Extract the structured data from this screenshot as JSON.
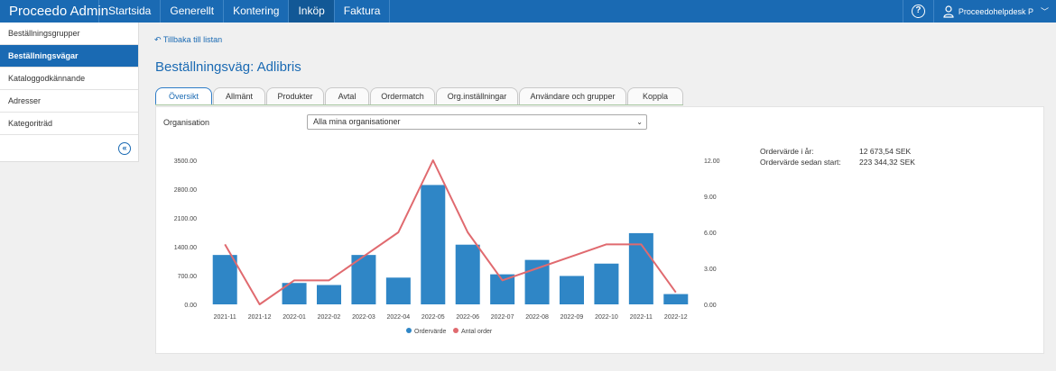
{
  "header": {
    "app_title": "Proceedo Admin",
    "nav": [
      {
        "label": "Startsida",
        "active": false
      },
      {
        "label": "Generellt",
        "active": false
      },
      {
        "label": "Kontering",
        "active": false
      },
      {
        "label": "Inköp",
        "active": true
      },
      {
        "label": "Faktura",
        "active": false
      }
    ],
    "help_icon": "?",
    "user_name": "Proceedohelpdesk P"
  },
  "sidebar": {
    "items": [
      {
        "label": "Beställningsgrupper",
        "active": false
      },
      {
        "label": "Beställningsvägar",
        "active": true
      },
      {
        "label": "Kataloggodkännande",
        "active": false
      },
      {
        "label": "Adresser",
        "active": false
      },
      {
        "label": "Kategoriträd",
        "active": false
      }
    ],
    "collapse_icon": "«"
  },
  "main": {
    "back_link": "Tillbaka till listan",
    "title": "Beställningsväg: Adlibris",
    "tabs": [
      {
        "label": "Översikt",
        "active": true
      },
      {
        "label": "Allmänt",
        "active": false
      },
      {
        "label": "Produkter",
        "active": false
      },
      {
        "label": "Avtal",
        "active": false
      },
      {
        "label": "Ordermatch",
        "active": false
      },
      {
        "label": "Org.inställningar",
        "active": false
      },
      {
        "label": "Användare och grupper",
        "active": false
      },
      {
        "label": "Koppla",
        "active": false
      }
    ],
    "org_label": "Organisation",
    "org_select_value": "Alla mina organisationer",
    "stats": [
      {
        "label": "Ordervärde i år:",
        "value": "12 673,54 SEK"
      },
      {
        "label": "Ordervärde sedan start:",
        "value": "223 344,32 SEK"
      }
    ]
  },
  "colors": {
    "accent": "#1a6ab3",
    "bar": "#2f86c6",
    "line": "#e06a6f"
  },
  "chart_data": {
    "type": "bar",
    "categories": [
      "2021-11",
      "2021-12",
      "2022-01",
      "2022-02",
      "2022-03",
      "2022-04",
      "2022-05",
      "2022-06",
      "2022-07",
      "2022-08",
      "2022-09",
      "2022-10",
      "2022-11",
      "2022-12"
    ],
    "series": [
      {
        "name": "Ordervärde",
        "type": "bar",
        "axis": "left",
        "values": [
          1200,
          0,
          520,
          470,
          1200,
          650,
          2900,
          1450,
          730,
          1080,
          690,
          990,
          1730,
          250
        ]
      },
      {
        "name": "Antal order",
        "type": "line",
        "axis": "right",
        "values": [
          5,
          0,
          2,
          2,
          4,
          6,
          12,
          6,
          2,
          3,
          4,
          5,
          5,
          1
        ]
      }
    ],
    "y_left": {
      "ticks": [
        "0.00",
        "700.00",
        "1400.00",
        "2100.00",
        "2800.00",
        "3500.00"
      ],
      "max": 3500
    },
    "y_right": {
      "ticks": [
        "0.00",
        "3.00",
        "6.00",
        "9.00",
        "12.00"
      ],
      "max": 12
    },
    "legend_position": "bottom",
    "grid": false
  }
}
